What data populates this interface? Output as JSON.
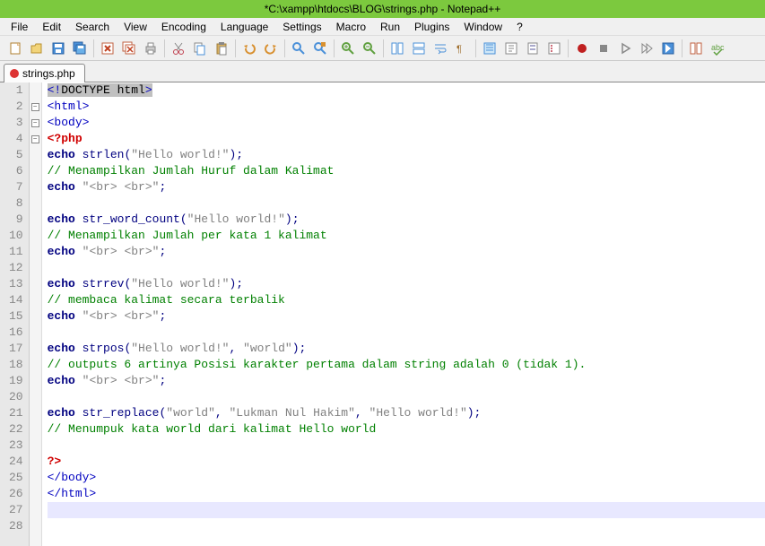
{
  "title": "*C:\\xampp\\htdocs\\BLOG\\strings.php - Notepad++",
  "menu": [
    "File",
    "Edit",
    "Search",
    "View",
    "Encoding",
    "Language",
    "Settings",
    "Macro",
    "Run",
    "Plugins",
    "Window",
    "?"
  ],
  "tab": {
    "label": "strings.php"
  },
  "lines": [
    1,
    2,
    3,
    4,
    5,
    6,
    7,
    8,
    9,
    10,
    11,
    12,
    13,
    14,
    15,
    16,
    17,
    18,
    19,
    20,
    21,
    22,
    23,
    24,
    25,
    26,
    27,
    28
  ],
  "code": {
    "l1_a": "<!",
    "l1_b": "DOCTYPE html",
    "l1_c": ">",
    "l2": "<html>",
    "l3": "<body>",
    "l4": "<?php",
    "l5_a": "echo",
    "l5_b": " strlen",
    "l5_c": "(",
    "l5_d": "\"Hello world!\"",
    "l5_e": ");",
    "l6": "// Menampilkan Jumlah Huruf dalam Kalimat",
    "l7_a": "echo",
    "l7_b": " ",
    "l7_c": "\"<br> <br>\"",
    "l7_d": ";",
    "l9_a": "echo",
    "l9_b": " str_word_count",
    "l9_c": "(",
    "l9_d": "\"Hello world!\"",
    "l9_e": ");",
    "l10": "// Menampilkan Jumlah per kata 1 kalimat",
    "l11_a": "echo",
    "l11_b": " ",
    "l11_c": "\"<br> <br>\"",
    "l11_d": ";",
    "l13_a": "echo",
    "l13_b": " strrev",
    "l13_c": "(",
    "l13_d": "\"Hello world!\"",
    "l13_e": ");",
    "l14": "// membaca kalimat secara terbalik",
    "l15_a": "echo",
    "l15_b": " ",
    "l15_c": "\"<br> <br>\"",
    "l15_d": ";",
    "l17_a": "echo",
    "l17_b": " strpos",
    "l17_c": "(",
    "l17_d": "\"Hello world!\"",
    "l17_e": ", ",
    "l17_f": "\"world\"",
    "l17_g": ");",
    "l18": "// outputs 6 artinya Posisi karakter pertama dalam string adalah 0 (tidak 1).",
    "l19_a": "echo",
    "l19_b": " ",
    "l19_c": "\"<br> <br>\"",
    "l19_d": ";",
    "l21_a": "echo",
    "l21_b": " str_replace",
    "l21_c": "(",
    "l21_d": "\"world\"",
    "l21_e": ", ",
    "l21_f": "\"Lukman Nul Hakim\"",
    "l21_g": ", ",
    "l21_h": "\"Hello world!\"",
    "l21_i": ");",
    "l22": "// Menumpuk kata world dari kalimat Hello world",
    "l24": "?>",
    "l25": "</body>",
    "l26": "</html>"
  }
}
